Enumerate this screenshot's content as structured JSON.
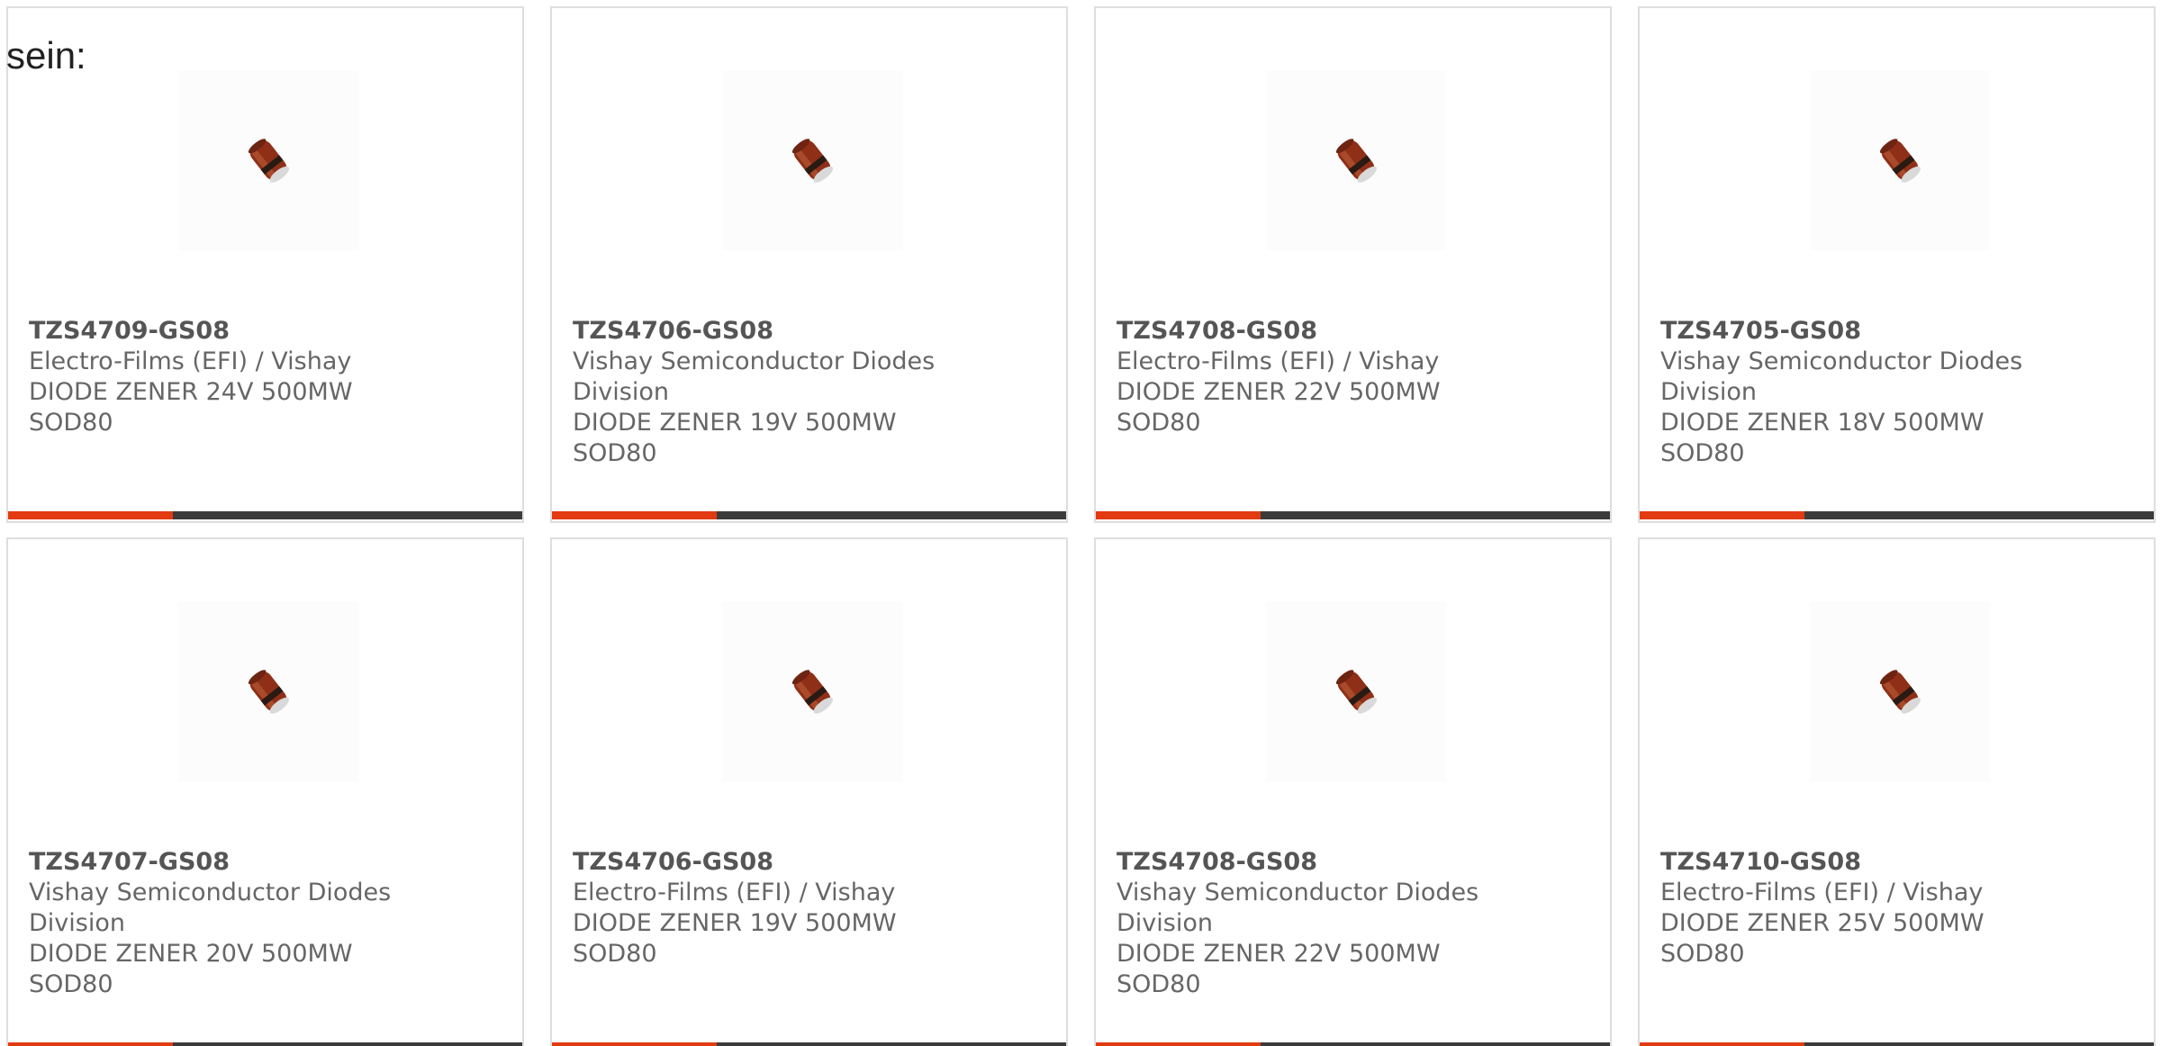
{
  "intro_text": "sein:",
  "products": [
    {
      "part": "TZS4709-GS08",
      "maker": "Electro-Films (EFI) / Vishay",
      "desc": "DIODE ZENER 24V 500MW",
      "pkg": "SOD80",
      "icon": "zener-diode-image"
    },
    {
      "part": "TZS4706-GS08",
      "maker": "Vishay Semiconductor Diodes Division",
      "desc": "DIODE ZENER 19V 500MW",
      "pkg": "SOD80",
      "icon": "zener-diode-image"
    },
    {
      "part": "TZS4708-GS08",
      "maker": "Electro-Films (EFI) / Vishay",
      "desc": "DIODE ZENER 22V 500MW",
      "pkg": "SOD80",
      "icon": "zener-diode-image"
    },
    {
      "part": "TZS4705-GS08",
      "maker": "Vishay Semiconductor Diodes Division",
      "desc": "DIODE ZENER 18V 500MW",
      "pkg": "SOD80",
      "icon": "zener-diode-image"
    },
    {
      "part": "TZS4707-GS08",
      "maker": "Vishay Semiconductor Diodes Division",
      "desc": "DIODE ZENER 20V 500MW",
      "pkg": "SOD80",
      "icon": "zener-diode-image"
    },
    {
      "part": "TZS4706-GS08",
      "maker": "Electro-Films (EFI) / Vishay",
      "desc": "DIODE ZENER 19V 500MW",
      "pkg": "SOD80",
      "icon": "zener-diode-image"
    },
    {
      "part": "TZS4708-GS08",
      "maker": "Vishay Semiconductor Diodes Division",
      "desc": "DIODE ZENER 22V 500MW",
      "pkg": "SOD80",
      "icon": "zener-diode-image"
    },
    {
      "part": "TZS4710-GS08",
      "maker": "Electro-Films (EFI) / Vishay",
      "desc": "DIODE ZENER 25V 500MW",
      "pkg": "SOD80",
      "icon": "zener-diode-image"
    }
  ],
  "colors": {
    "accent": "#e23b12",
    "bar": "#3b3b3b",
    "text": "#666666",
    "border": "#dedede"
  }
}
